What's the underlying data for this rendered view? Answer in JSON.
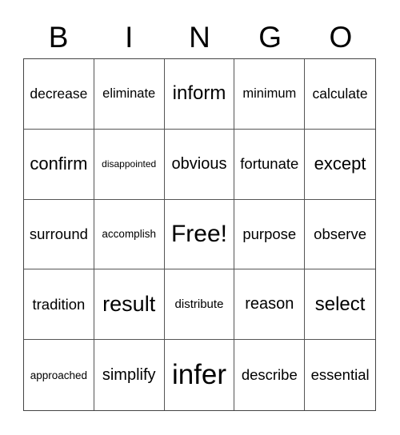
{
  "header": {
    "letters": [
      "B",
      "I",
      "N",
      "G",
      "O"
    ]
  },
  "card": {
    "rows": [
      [
        "decrease",
        "eliminate",
        "inform",
        "minimum",
        "calculate"
      ],
      [
        "confirm",
        "disappointed",
        "obvious",
        "fortunate",
        "except"
      ],
      [
        "surround",
        "accomplish",
        "Free!",
        "purpose",
        "observe"
      ],
      [
        "tradition",
        "result",
        "distribute",
        "reason",
        "select"
      ],
      [
        "approached",
        "simplify",
        "infer",
        "describe",
        "essential"
      ]
    ],
    "free_space": "Free!"
  }
}
